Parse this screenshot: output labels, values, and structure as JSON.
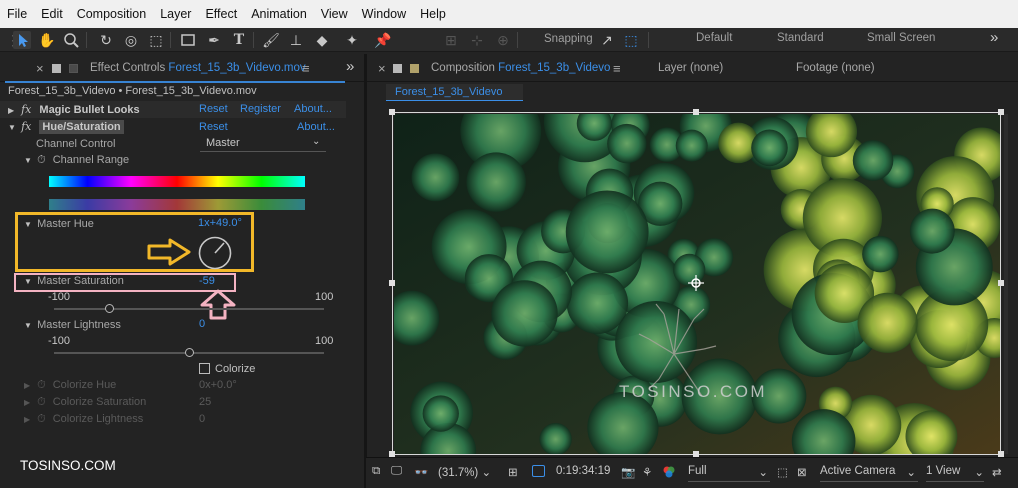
{
  "menu": [
    "File",
    "Edit",
    "Composition",
    "Layer",
    "Effect",
    "Animation",
    "View",
    "Window",
    "Help"
  ],
  "toolbar": {
    "snapping_label": "Snapping",
    "workspaces": [
      "Default",
      "Standard",
      "Small Screen"
    ],
    "more": "»"
  },
  "effect_controls": {
    "tab_close": "×",
    "tab_title": "Effect Controls",
    "tab_file": "Forest_15_3b_Videvo.mov",
    "tab_menu": "≡",
    "collapse": "»",
    "breadcrumb": "Forest_15_3b_Videvo • Forest_15_3b_Videvo.mov",
    "effects": [
      {
        "name": "Magic Bullet Looks",
        "reset": "Reset",
        "register": "Register",
        "about": "About..."
      },
      {
        "name": "Hue/Saturation",
        "reset": "Reset",
        "about": "About..."
      }
    ],
    "channel_control_label": "Channel Control",
    "channel_control_value": "Master",
    "channel_range_label": "Channel Range",
    "master_hue_label": "Master Hue",
    "master_hue_value": "1x+49.0°",
    "master_saturation_label": "Master Saturation",
    "master_saturation_value": "-59",
    "master_saturation_min": "-100",
    "master_saturation_max": "100",
    "master_saturation_level": -59,
    "master_lightness_label": "Master Lightness",
    "master_lightness_value": "0",
    "master_lightness_min": "-100",
    "master_lightness_max": "100",
    "master_lightness_level": 0,
    "colorize_label": "Colorize",
    "colorize_hue_label": "Colorize Hue",
    "colorize_hue_value": "0x+0.0°",
    "colorize_saturation_label": "Colorize Saturation",
    "colorize_saturation_value": "25",
    "colorize_lightness_label": "Colorize Lightness",
    "colorize_lightness_value": "0",
    "watermark": "TOSINSO.COM"
  },
  "composition": {
    "tab_close": "×",
    "tab_title": "Composition",
    "tab_name": "Forest_15_3b_Videvo",
    "tab_menu": "≡",
    "layer_tab": "Layer (none)",
    "footage_tab": "Footage (none)",
    "comp_tab": "Forest_15_3b_Videvo",
    "viewer_watermark": "TOSINSO.COM"
  },
  "viewer_bar": {
    "zoom": "(31.7%)",
    "timecode": "0:19:34:19",
    "resolution": "Full",
    "camera": "Active Camera",
    "views": "1 View"
  },
  "colors": {
    "accent_blue": "#3b8fe8",
    "annotation_orange": "#f2b829",
    "annotation_pink": "#f4b3c2"
  }
}
